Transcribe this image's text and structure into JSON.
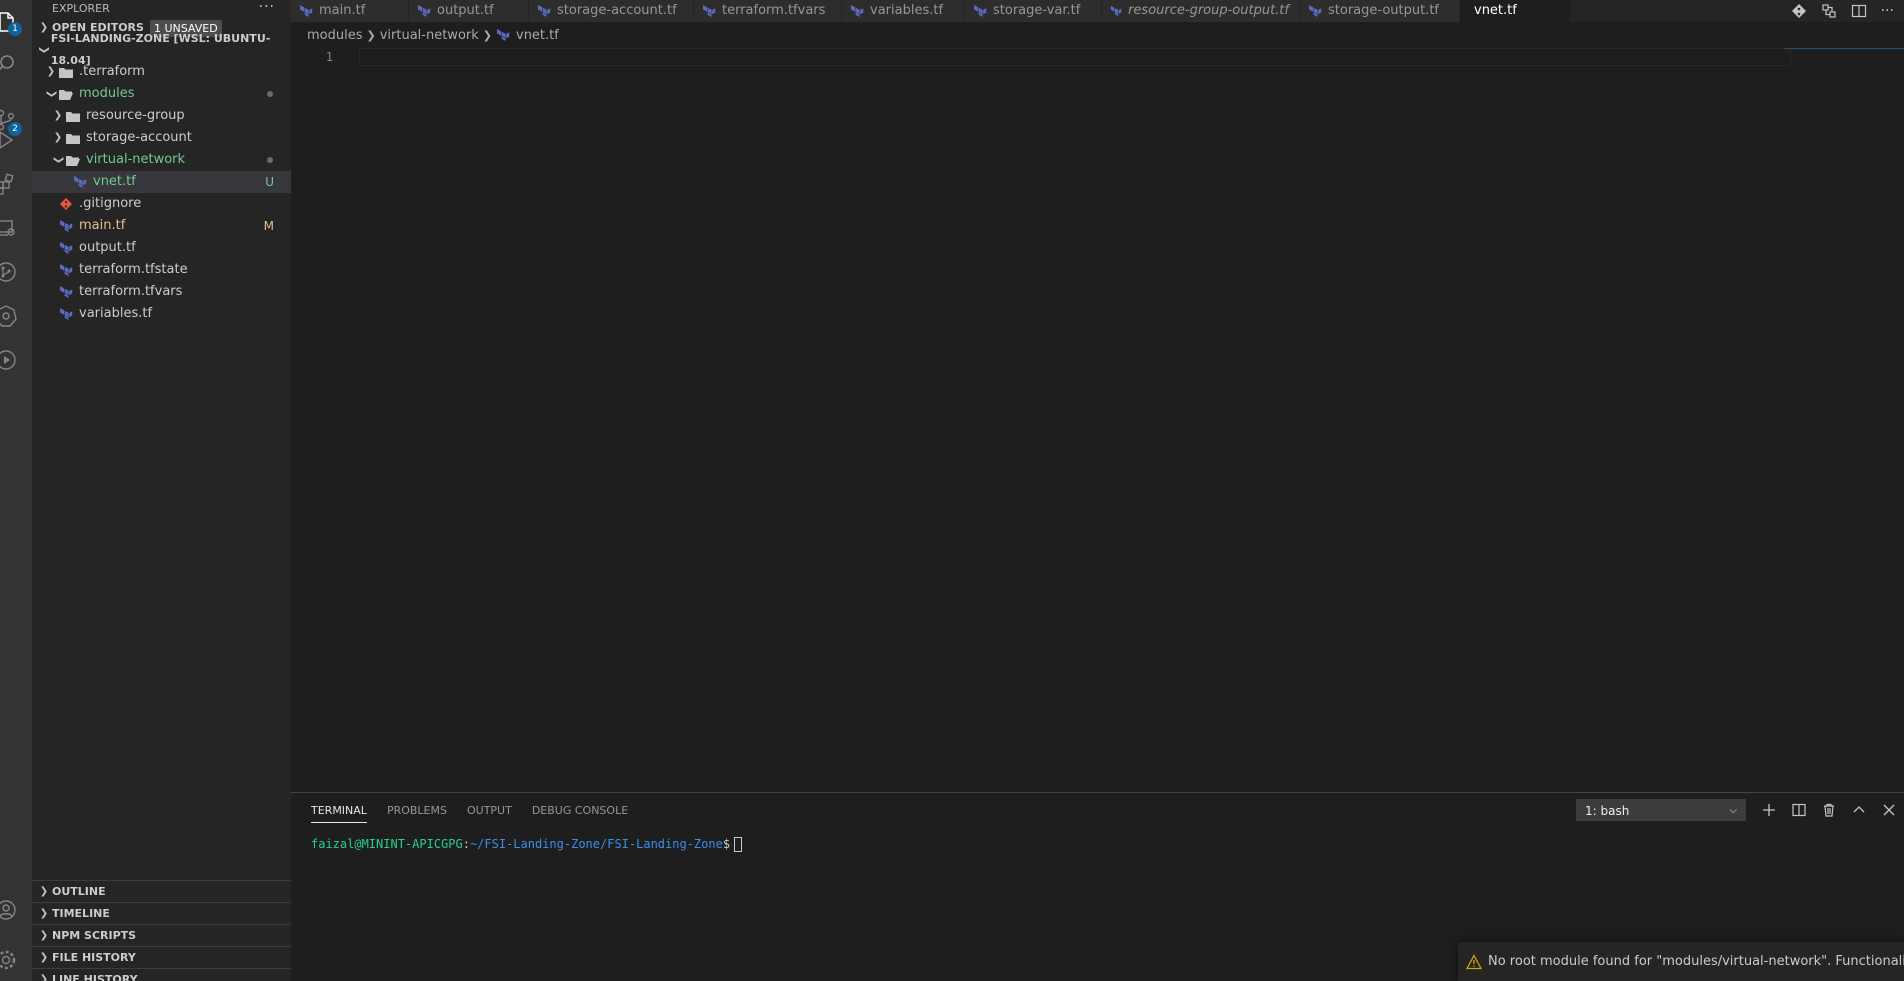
{
  "activity_bar": {
    "explorer_badge": "1",
    "scm_badge": "2",
    "icons": [
      "files-icon",
      "search-icon",
      "source-control-icon",
      "run-debug-icon",
      "extensions-icon",
      "remote-explorer-icon",
      "git-graph-icon",
      "kubernetes-icon",
      "play-icon",
      "account-icon",
      "gear-icon"
    ]
  },
  "sidebar": {
    "title": "EXPLORER",
    "more_actions": "···",
    "open_editors": {
      "label": "OPEN EDITORS",
      "badge": "1 UNSAVED"
    },
    "workspace": {
      "label": "FSI-LANDING-ZONE [WSL: UBUNTU-18.04]"
    },
    "tree": [
      {
        "label": ".terraform",
        "type": "folder",
        "expanded": false,
        "depth": 1
      },
      {
        "label": "modules",
        "type": "folder",
        "expanded": true,
        "depth": 1,
        "modified_dot": true
      },
      {
        "label": "resource-group",
        "type": "folder",
        "expanded": false,
        "depth": 2
      },
      {
        "label": "storage-account",
        "type": "folder",
        "expanded": false,
        "depth": 2
      },
      {
        "label": "virtual-network",
        "type": "folder",
        "expanded": true,
        "depth": 2,
        "modified_dot": true
      },
      {
        "label": "vnet.tf",
        "type": "tf",
        "depth": 3,
        "status": "U",
        "selected": true
      },
      {
        "label": ".gitignore",
        "type": "git",
        "depth": 1
      },
      {
        "label": "main.tf",
        "type": "tf",
        "depth": 1,
        "status": "M"
      },
      {
        "label": "output.tf",
        "type": "tf",
        "depth": 1
      },
      {
        "label": "terraform.tfstate",
        "type": "tf",
        "depth": 1
      },
      {
        "label": "terraform.tfvars",
        "type": "tf",
        "depth": 1
      },
      {
        "label": "variables.tf",
        "type": "tf",
        "depth": 1
      }
    ],
    "bottom_sections": [
      "OUTLINE",
      "TIMELINE",
      "NPM SCRIPTS",
      "FILE HISTORY",
      "LINE HISTORY"
    ]
  },
  "tabs": [
    {
      "label": "main.tf",
      "width": 118
    },
    {
      "label": "output.tf",
      "width": 120
    },
    {
      "label": "storage-account.tf",
      "width": 165
    },
    {
      "label": "terraform.tfvars",
      "width": 148
    },
    {
      "label": "variables.tf",
      "width": 123
    },
    {
      "label": "storage-var.tf",
      "width": 137
    },
    {
      "label": "resource-group-output.tf",
      "width": 198,
      "italic": true
    },
    {
      "label": "storage-output.tf",
      "width": 160
    },
    {
      "label": "vnet.tf",
      "width": 111,
      "active": true,
      "unsaved": true
    }
  ],
  "breadcrumb": [
    "modules",
    "virtual-network",
    "vnet.tf"
  ],
  "editor": {
    "line_numbers": [
      "1"
    ]
  },
  "panel": {
    "tabs": [
      "TERMINAL",
      "PROBLEMS",
      "OUTPUT",
      "DEBUG CONSOLE"
    ],
    "terminal_select": "1: bash",
    "prompt_user": "faizal@MININT-APICGPG",
    "prompt_sep": ":",
    "prompt_path": "~/FSI-Landing-Zone/FSI-Landing-Zone",
    "prompt_symbol": "$"
  },
  "notification": {
    "text": "No root module found for \"modules/virtual-network\". Functionality m..."
  },
  "colors": {
    "accent": "#0e639c",
    "terraform_icon": "#5c6bc0",
    "git_icon": "#e55a38",
    "untracked": "#73c991",
    "modified": "#e2c08d",
    "warning": "#cca700"
  }
}
